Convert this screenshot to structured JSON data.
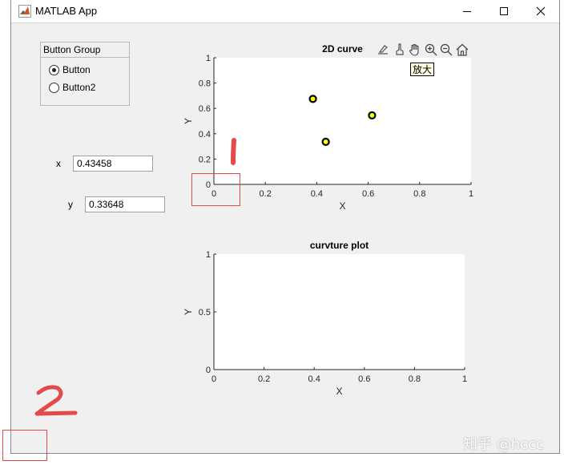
{
  "window": {
    "title": "MATLAB App",
    "minimize_icon": "minimize-icon",
    "maximize_icon": "maximize-icon",
    "close_icon": "close-icon"
  },
  "button_group": {
    "title": "Button Group",
    "options": [
      {
        "label": "Button",
        "selected": true
      },
      {
        "label": "Button2",
        "selected": false
      }
    ]
  },
  "fields": {
    "x": {
      "label": "x",
      "value": "0.43458"
    },
    "y": {
      "label": "y",
      "value": "0.33648"
    }
  },
  "toolbar": {
    "icons": [
      "export-icon",
      "brush-icon",
      "pan-hand-icon",
      "zoom-in-icon",
      "zoom-out-icon",
      "home-icon"
    ],
    "tooltip": "放大"
  },
  "annotations": {
    "mark1": "1",
    "mark2": "2",
    "color": "#e34a4a"
  },
  "watermark": "知乎 @hccc",
  "chart_data": [
    {
      "type": "scatter",
      "title": "2D curve",
      "xlabel": "X",
      "ylabel": "Y",
      "xlim": [
        0,
        1
      ],
      "ylim": [
        0,
        1
      ],
      "xticks": [
        "0",
        "0.2",
        "0.4",
        "0.6",
        "0.8",
        "1"
      ],
      "yticks": [
        "0",
        "0.2",
        "0.4",
        "0.6",
        "0.8",
        "1"
      ],
      "grid": false,
      "marker_face": "#ffff00",
      "marker_edge": "#000000",
      "points": [
        {
          "x": 0.385,
          "y": 0.675
        },
        {
          "x": 0.435,
          "y": 0.336
        },
        {
          "x": 0.615,
          "y": 0.545
        }
      ]
    },
    {
      "type": "line",
      "title": "curvture plot",
      "xlabel": "X",
      "ylabel": "Y",
      "xlim": [
        0,
        1
      ],
      "ylim": [
        0,
        1
      ],
      "xticks": [
        "0",
        "0.2",
        "0.4",
        "0.6",
        "0.8",
        "1"
      ],
      "yticks": [
        "0",
        "0.5",
        "1"
      ],
      "grid": false,
      "series": []
    }
  ]
}
